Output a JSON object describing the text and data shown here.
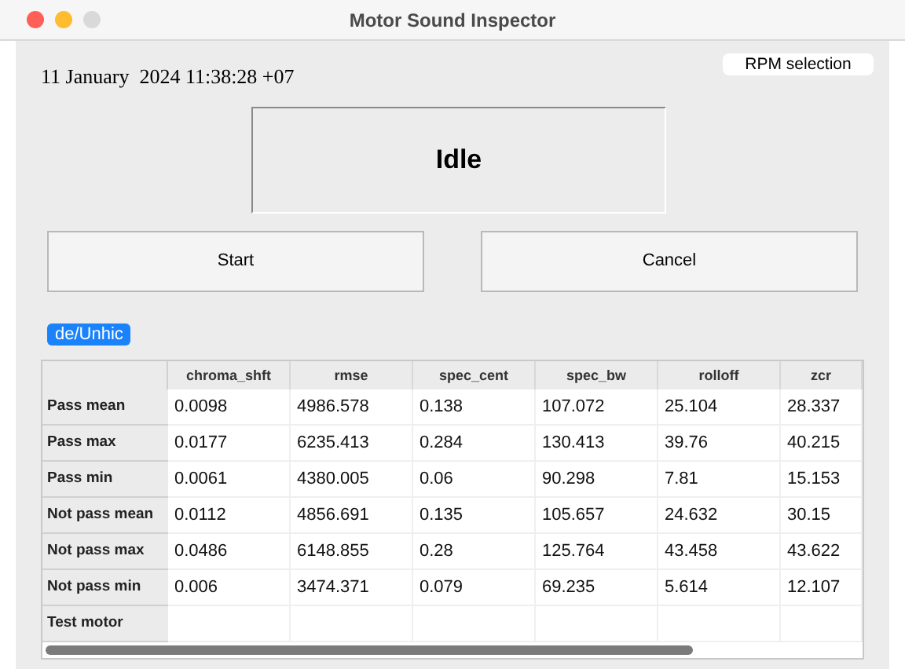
{
  "window": {
    "title": "Motor Sound Inspector"
  },
  "datetime": "11 January  2024 11:38:28 +07",
  "rpm_button": "RPM selection",
  "status": "Idle",
  "buttons": [
    "Start",
    "Cancel"
  ],
  "tab": {
    "label": "de/Unhic",
    "selected": true
  },
  "table": {
    "columns": [
      "chroma_shft",
      "rmse",
      "spec_cent",
      "spec_bw",
      "rolloff",
      "zcr"
    ],
    "rows": [
      {
        "label": "Pass mean",
        "cells": [
          "0.0098",
          "4986.578",
          "0.138",
          "107.072",
          "25.104",
          "28.337"
        ]
      },
      {
        "label": "Pass max",
        "cells": [
          "0.0177",
          "6235.413",
          "0.284",
          "130.413",
          "39.76",
          "40.215"
        ]
      },
      {
        "label": "Pass min",
        "cells": [
          "0.0061",
          "4380.005",
          "0.06",
          "90.298",
          "7.81",
          "15.153"
        ]
      },
      {
        "label": "Not pass mean",
        "cells": [
          "0.0112",
          "4856.691",
          "0.135",
          "105.657",
          "24.632",
          "30.15"
        ]
      },
      {
        "label": "Not pass max",
        "cells": [
          "0.0486",
          "6148.855",
          "0.28",
          "125.764",
          "43.458",
          "43.622"
        ]
      },
      {
        "label": "Not pass min",
        "cells": [
          "0.006",
          "3474.371",
          "0.079",
          "69.235",
          "5.614",
          "12.107"
        ]
      },
      {
        "label": "Test motor",
        "cells": [
          "",
          "",
          "",
          "",
          "",
          ""
        ]
      }
    ]
  }
}
